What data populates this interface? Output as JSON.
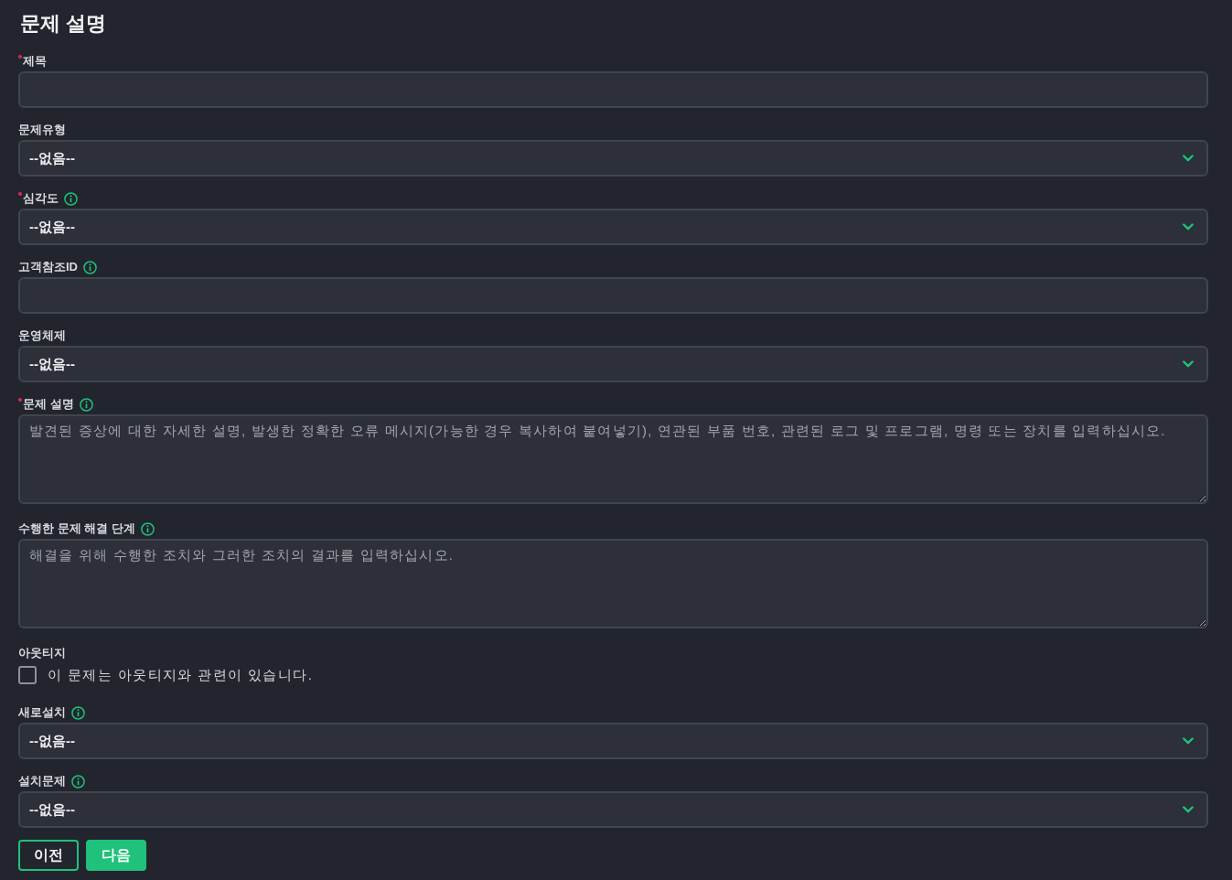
{
  "title": "문제 설명",
  "fields": [
    {
      "kind": "text",
      "label": "제목",
      "required": true,
      "info": false
    },
    {
      "kind": "select",
      "label": "문제유형",
      "required": false,
      "info": false,
      "value": "--없음--"
    },
    {
      "kind": "select",
      "label": "심각도",
      "required": true,
      "info": true,
      "value": "--없음--"
    },
    {
      "kind": "text",
      "label": "고객참조ID",
      "required": false,
      "info": true
    },
    {
      "kind": "select",
      "label": "운영체제",
      "required": false,
      "info": false,
      "value": "--없음--"
    },
    {
      "kind": "textarea",
      "label": "문제 설명",
      "required": true,
      "info": true,
      "placeholder": "발견된 증상에 대한 자세한 설명, 발생한 정확한 오류 메시지(가능한 경우 복사하여 붙여넣기), 연관된 부품 번호, 관련된 로그 및 프로그램, 명령 또는 장치를 입력하십시오."
    },
    {
      "kind": "textarea",
      "label": "수행한 문제 해결 단계",
      "required": false,
      "info": true,
      "placeholder": "해결을 위해 수행한 조치와 그러한 조치의 결과를 입력하십시오."
    },
    {
      "kind": "checkbox",
      "label": "아웃티지",
      "required": false,
      "info": false,
      "option": "이 문제는 아웃티지와 관련이 있습니다.",
      "checked": false
    },
    {
      "kind": "select",
      "label": "새로설치",
      "required": false,
      "info": true,
      "value": "--없음--"
    },
    {
      "kind": "select",
      "label": "설치문제",
      "required": false,
      "info": true,
      "value": "--없음--"
    }
  ],
  "buttons": [
    {
      "kind": "outline",
      "label": "이전"
    },
    {
      "kind": "primary",
      "label": "다음"
    }
  ]
}
